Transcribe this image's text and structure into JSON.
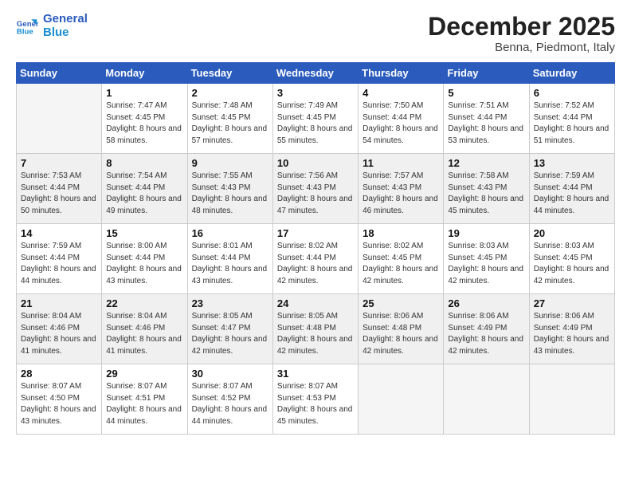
{
  "header": {
    "logo_line1": "General",
    "logo_line2": "Blue",
    "month": "December 2025",
    "location": "Benna, Piedmont, Italy"
  },
  "weekdays": [
    "Sunday",
    "Monday",
    "Tuesday",
    "Wednesday",
    "Thursday",
    "Friday",
    "Saturday"
  ],
  "weeks": [
    [
      {
        "day": "",
        "empty": true
      },
      {
        "day": "1",
        "sunrise": "7:47 AM",
        "sunset": "4:45 PM",
        "daylight": "8 hours and 58 minutes."
      },
      {
        "day": "2",
        "sunrise": "7:48 AM",
        "sunset": "4:45 PM",
        "daylight": "8 hours and 57 minutes."
      },
      {
        "day": "3",
        "sunrise": "7:49 AM",
        "sunset": "4:45 PM",
        "daylight": "8 hours and 55 minutes."
      },
      {
        "day": "4",
        "sunrise": "7:50 AM",
        "sunset": "4:44 PM",
        "daylight": "8 hours and 54 minutes."
      },
      {
        "day": "5",
        "sunrise": "7:51 AM",
        "sunset": "4:44 PM",
        "daylight": "8 hours and 53 minutes."
      },
      {
        "day": "6",
        "sunrise": "7:52 AM",
        "sunset": "4:44 PM",
        "daylight": "8 hours and 51 minutes."
      }
    ],
    [
      {
        "day": "7",
        "sunrise": "7:53 AM",
        "sunset": "4:44 PM",
        "daylight": "8 hours and 50 minutes."
      },
      {
        "day": "8",
        "sunrise": "7:54 AM",
        "sunset": "4:44 PM",
        "daylight": "8 hours and 49 minutes."
      },
      {
        "day": "9",
        "sunrise": "7:55 AM",
        "sunset": "4:43 PM",
        "daylight": "8 hours and 48 minutes."
      },
      {
        "day": "10",
        "sunrise": "7:56 AM",
        "sunset": "4:43 PM",
        "daylight": "8 hours and 47 minutes."
      },
      {
        "day": "11",
        "sunrise": "7:57 AM",
        "sunset": "4:43 PM",
        "daylight": "8 hours and 46 minutes."
      },
      {
        "day": "12",
        "sunrise": "7:58 AM",
        "sunset": "4:43 PM",
        "daylight": "8 hours and 45 minutes."
      },
      {
        "day": "13",
        "sunrise": "7:59 AM",
        "sunset": "4:44 PM",
        "daylight": "8 hours and 44 minutes."
      }
    ],
    [
      {
        "day": "14",
        "sunrise": "7:59 AM",
        "sunset": "4:44 PM",
        "daylight": "8 hours and 44 minutes."
      },
      {
        "day": "15",
        "sunrise": "8:00 AM",
        "sunset": "4:44 PM",
        "daylight": "8 hours and 43 minutes."
      },
      {
        "day": "16",
        "sunrise": "8:01 AM",
        "sunset": "4:44 PM",
        "daylight": "8 hours and 43 minutes."
      },
      {
        "day": "17",
        "sunrise": "8:02 AM",
        "sunset": "4:44 PM",
        "daylight": "8 hours and 42 minutes."
      },
      {
        "day": "18",
        "sunrise": "8:02 AM",
        "sunset": "4:45 PM",
        "daylight": "8 hours and 42 minutes."
      },
      {
        "day": "19",
        "sunrise": "8:03 AM",
        "sunset": "4:45 PM",
        "daylight": "8 hours and 42 minutes."
      },
      {
        "day": "20",
        "sunrise": "8:03 AM",
        "sunset": "4:45 PM",
        "daylight": "8 hours and 42 minutes."
      }
    ],
    [
      {
        "day": "21",
        "sunrise": "8:04 AM",
        "sunset": "4:46 PM",
        "daylight": "8 hours and 41 minutes."
      },
      {
        "day": "22",
        "sunrise": "8:04 AM",
        "sunset": "4:46 PM",
        "daylight": "8 hours and 41 minutes."
      },
      {
        "day": "23",
        "sunrise": "8:05 AM",
        "sunset": "4:47 PM",
        "daylight": "8 hours and 42 minutes."
      },
      {
        "day": "24",
        "sunrise": "8:05 AM",
        "sunset": "4:48 PM",
        "daylight": "8 hours and 42 minutes."
      },
      {
        "day": "25",
        "sunrise": "8:06 AM",
        "sunset": "4:48 PM",
        "daylight": "8 hours and 42 minutes."
      },
      {
        "day": "26",
        "sunrise": "8:06 AM",
        "sunset": "4:49 PM",
        "daylight": "8 hours and 42 minutes."
      },
      {
        "day": "27",
        "sunrise": "8:06 AM",
        "sunset": "4:49 PM",
        "daylight": "8 hours and 43 minutes."
      }
    ],
    [
      {
        "day": "28",
        "sunrise": "8:07 AM",
        "sunset": "4:50 PM",
        "daylight": "8 hours and 43 minutes."
      },
      {
        "day": "29",
        "sunrise": "8:07 AM",
        "sunset": "4:51 PM",
        "daylight": "8 hours and 44 minutes."
      },
      {
        "day": "30",
        "sunrise": "8:07 AM",
        "sunset": "4:52 PM",
        "daylight": "8 hours and 44 minutes."
      },
      {
        "day": "31",
        "sunrise": "8:07 AM",
        "sunset": "4:53 PM",
        "daylight": "8 hours and 45 minutes."
      },
      {
        "day": "",
        "empty": true
      },
      {
        "day": "",
        "empty": true
      },
      {
        "day": "",
        "empty": true
      }
    ]
  ]
}
